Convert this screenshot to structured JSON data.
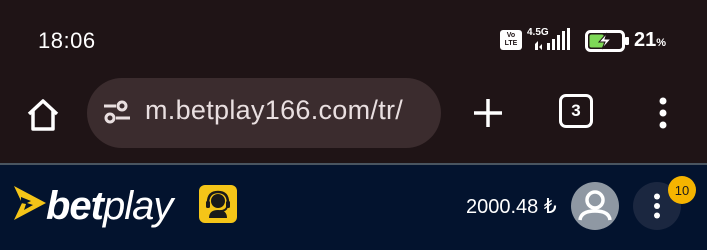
{
  "status_bar": {
    "time": "18:06",
    "volte_label": "Vo\nLTE",
    "network": "4.5G",
    "battery_percent": "21",
    "battery_pct_symbol": "%",
    "battery_level": 0.21,
    "battery_charging": true,
    "battery_color": "#7ed957",
    "icons": [
      "volte-icon",
      "signal-icon",
      "battery-charging-icon"
    ]
  },
  "browser": {
    "url": "m.betplay166.com/tr/",
    "tab_count": "3",
    "icons": [
      "home-icon",
      "site-settings-icon",
      "plus-icon",
      "tab-switcher-icon",
      "more-vert-icon"
    ]
  },
  "site_header": {
    "logo_bet": "bet",
    "logo_play": "play",
    "balance": "2000.48 ₺",
    "notification_count": "10",
    "colors": {
      "background": "#03132e",
      "accent": "#f5c518",
      "badge": "#f5b400"
    },
    "icons": [
      "betplay-logo-icon",
      "support-agent-icon",
      "user-avatar-icon",
      "more-vert-icon"
    ]
  }
}
